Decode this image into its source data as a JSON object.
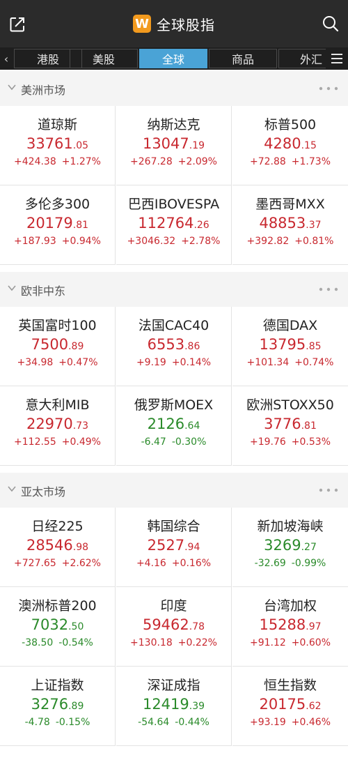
{
  "app": {
    "title": "全球股指",
    "logo_letter": "W"
  },
  "tabs": [
    "港股",
    "美股",
    "全球",
    "商品",
    "外汇"
  ],
  "active_tab": 2,
  "sections": [
    {
      "title": "美洲市场",
      "items": [
        {
          "name": "道琼斯",
          "price_int": "33761",
          "price_dec": ".05",
          "change": "+424.38",
          "pct": "+1.27%",
          "dir": "up"
        },
        {
          "name": "纳斯达克",
          "price_int": "13047",
          "price_dec": ".19",
          "change": "+267.28",
          "pct": "+2.09%",
          "dir": "up"
        },
        {
          "name": "标普500",
          "price_int": "4280",
          "price_dec": ".15",
          "change": "+72.88",
          "pct": "+1.73%",
          "dir": "up"
        },
        {
          "name": "多伦多300",
          "price_int": "20179",
          "price_dec": ".81",
          "change": "+187.93",
          "pct": "+0.94%",
          "dir": "up"
        },
        {
          "name": "巴西IBOVESPA",
          "price_int": "112764",
          "price_dec": ".26",
          "change": "+3046.32",
          "pct": "+2.78%",
          "dir": "up"
        },
        {
          "name": "墨西哥MXX",
          "price_int": "48853",
          "price_dec": ".37",
          "change": "+392.82",
          "pct": "+0.81%",
          "dir": "up"
        }
      ]
    },
    {
      "title": "欧非中东",
      "items": [
        {
          "name": "英国富时100",
          "price_int": "7500",
          "price_dec": ".89",
          "change": "+34.98",
          "pct": "+0.47%",
          "dir": "up"
        },
        {
          "name": "法国CAC40",
          "price_int": "6553",
          "price_dec": ".86",
          "change": "+9.19",
          "pct": "+0.14%",
          "dir": "up"
        },
        {
          "name": "德国DAX",
          "price_int": "13795",
          "price_dec": ".85",
          "change": "+101.34",
          "pct": "+0.74%",
          "dir": "up"
        },
        {
          "name": "意大利MIB",
          "price_int": "22970",
          "price_dec": ".73",
          "change": "+112.55",
          "pct": "+0.49%",
          "dir": "up"
        },
        {
          "name": "俄罗斯MOEX",
          "price_int": "2126",
          "price_dec": ".64",
          "change": "-6.47",
          "pct": "-0.30%",
          "dir": "down"
        },
        {
          "name": "欧洲STOXX50",
          "price_int": "3776",
          "price_dec": ".81",
          "change": "+19.76",
          "pct": "+0.53%",
          "dir": "up"
        }
      ]
    },
    {
      "title": "亚太市场",
      "items": [
        {
          "name": "日经225",
          "price_int": "28546",
          "price_dec": ".98",
          "change": "+727.65",
          "pct": "+2.62%",
          "dir": "up"
        },
        {
          "name": "韩国综合",
          "price_int": "2527",
          "price_dec": ".94",
          "change": "+4.16",
          "pct": "+0.16%",
          "dir": "up"
        },
        {
          "name": "新加坡海峡",
          "price_int": "3269",
          "price_dec": ".27",
          "change": "-32.69",
          "pct": "-0.99%",
          "dir": "down"
        },
        {
          "name": "澳洲标普200",
          "price_int": "7032",
          "price_dec": ".50",
          "change": "-38.50",
          "pct": "-0.54%",
          "dir": "down"
        },
        {
          "name": "印度",
          "price_int": "59462",
          "price_dec": ".78",
          "change": "+130.18",
          "pct": "+0.22%",
          "dir": "up"
        },
        {
          "name": "台湾加权",
          "price_int": "15288",
          "price_dec": ".97",
          "change": "+91.12",
          "pct": "+0.60%",
          "dir": "up"
        },
        {
          "name": "上证指数",
          "price_int": "3276",
          "price_dec": ".89",
          "change": "-4.78",
          "pct": "-0.15%",
          "dir": "down"
        },
        {
          "name": "深证成指",
          "price_int": "12419",
          "price_dec": ".39",
          "change": "-54.64",
          "pct": "-0.44%",
          "dir": "down"
        },
        {
          "name": "恒生指数",
          "price_int": "20175",
          "price_dec": ".62",
          "change": "+93.19",
          "pct": "+0.46%",
          "dir": "up"
        }
      ]
    }
  ],
  "colors": {
    "up": "#c8282f",
    "down": "#2a8a2a",
    "active_tab": "#4aa3d6",
    "logo": "#f29a1e"
  },
  "icons": {
    "share": "share-icon",
    "search": "search-icon",
    "menu": "menu-icon",
    "more": "more-dots-icon",
    "collapse": "chevron-down-icon"
  }
}
